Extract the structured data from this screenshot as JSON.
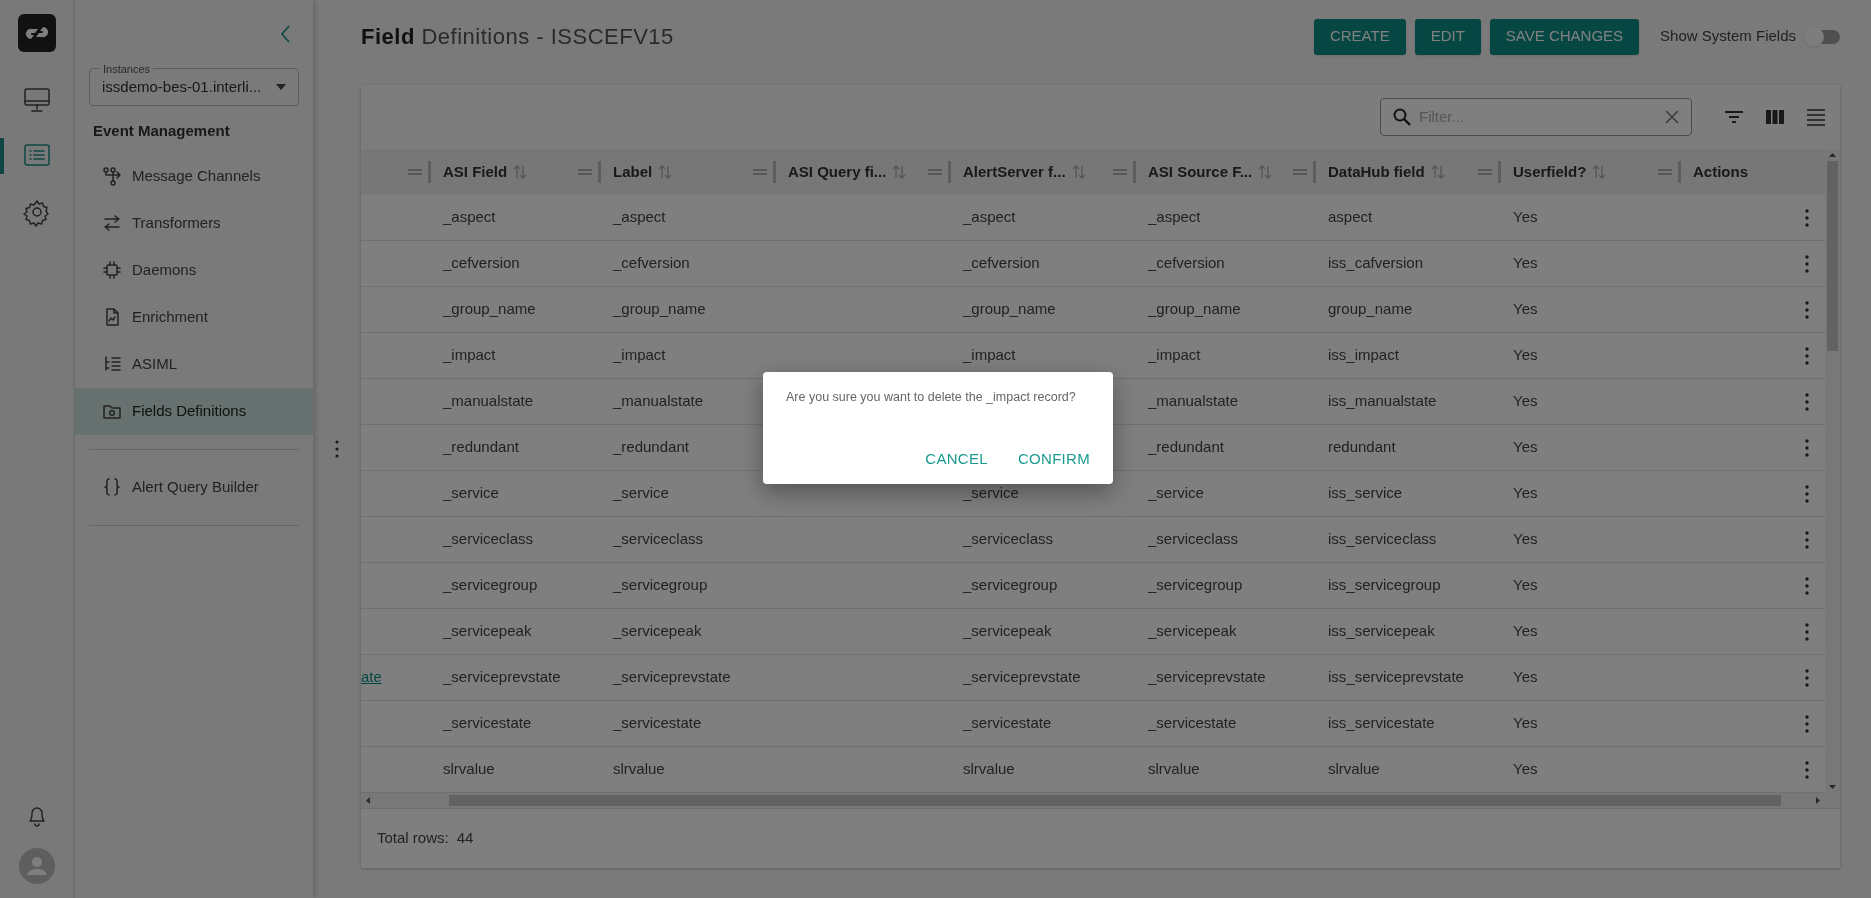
{
  "rail": {
    "items": [
      {
        "kind": "monitor",
        "selected": false
      },
      {
        "kind": "list",
        "selected": true
      },
      {
        "kind": "settings",
        "selected": false
      }
    ]
  },
  "sidebar": {
    "instances_label": "Instances",
    "instance_value": "issdemo-bes-01.interli...",
    "section_title": "Event Management",
    "items": [
      {
        "label": "Message Channels",
        "kind": "channels",
        "selected": false
      },
      {
        "label": "Transformers",
        "kind": "transform",
        "selected": false
      },
      {
        "label": "Daemons",
        "kind": "chip",
        "selected": false
      },
      {
        "label": "Enrichment",
        "kind": "file",
        "selected": false
      },
      {
        "label": "ASIML",
        "kind": "tree",
        "selected": false
      },
      {
        "label": "Fields Definitions",
        "kind": "folder",
        "selected": true
      }
    ],
    "bottom_items": [
      {
        "label": "Alert Query Builder",
        "kind": "braces",
        "selected": false
      }
    ]
  },
  "page": {
    "title": "**Field** Definitions - ISSCEFV15"
  },
  "buttons": [
    "CREATE",
    "EDIT",
    "SAVE CHANGES"
  ],
  "show_system_fields": {
    "label": "Show System Fields",
    "on": false
  },
  "filter": {
    "placeholder": "Filter..."
  },
  "table": {
    "columns": [
      "ASI Field",
      "Label",
      "ASI Query fi...",
      "AlertServer f...",
      "ASI Source F...",
      "DataHub field",
      "Userfield?",
      "Actions"
    ],
    "rows": [
      {
        "asi_field": "_aspect",
        "label": "_aspect",
        "alertserver": "_aspect",
        "asi_source": "_aspect",
        "datahub_field": "aspect",
        "userfield": "Yes"
      },
      {
        "asi_field": "_cefversion",
        "label": "_cefversion",
        "alertserver": "_cefversion",
        "asi_source": "_cefversion",
        "datahub_field": "iss_cafversion",
        "userfield": "Yes"
      },
      {
        "asi_field": "_group_name",
        "label": "_group_name",
        "alertserver": "_group_name",
        "asi_source": "_group_name",
        "datahub_field": "group_name",
        "userfield": "Yes"
      },
      {
        "asi_field": "_impact",
        "label": "_impact",
        "alertserver": "_impact",
        "asi_source": "_impact",
        "datahub_field": "iss_impact",
        "userfield": "Yes"
      },
      {
        "asi_field": "_manualstate",
        "label": "_manualstate",
        "asi_source": "_manualstate",
        "datahub_field": "iss_manualstate",
        "userfield": "Yes"
      },
      {
        "asi_field": "_redundant",
        "label": "_redundant",
        "asi_source": "_redundant",
        "datahub_field": "redundant",
        "userfield": "Yes"
      },
      {
        "asi_field": "_service",
        "label": "_service",
        "alertserver": "_service",
        "asi_source": "_service",
        "datahub_field": "iss_service",
        "userfield": "Yes"
      },
      {
        "asi_field": "_serviceclass",
        "label": "_serviceclass",
        "alertserver": "_serviceclass",
        "asi_source": "_serviceclass",
        "datahub_field": "iss_serviceclass",
        "userfield": "Yes"
      },
      {
        "asi_field": "_servicegroup",
        "label": "_servicegroup",
        "alertserver": "_servicegroup",
        "asi_source": "_servicegroup",
        "datahub_field": "iss_servicegroup",
        "userfield": "Yes"
      },
      {
        "asi_field": "_servicepeak",
        "label": "_servicepeak",
        "alertserver": "_servicepeak",
        "asi_source": "_servicepeak",
        "datahub_field": "iss_servicepeak",
        "userfield": "Yes"
      },
      {
        "column_1": "ate",
        "asi_field": "_serviceprevstate",
        "label": "_serviceprevstate",
        "alertserver": "_serviceprevstate",
        "asi_source": "_serviceprevstate",
        "datahub_field": "iss_serviceprevstate",
        "userfield": "Yes"
      },
      {
        "asi_field": "_servicestate",
        "label": "_servicestate",
        "alertserver": "_servicestate",
        "asi_source": "_servicestate",
        "datahub_field": "iss_servicestate",
        "userfield": "Yes"
      },
      {
        "asi_field": "slrvalue",
        "label": "slrvalue",
        "alertserver": "slrvalue",
        "asi_source": "slrvalue",
        "datahub_field": "slrvalue",
        "userfield": "Yes"
      }
    ]
  },
  "footer": {
    "label": "Total rows:",
    "count": "44"
  },
  "dialog": {
    "message": "Are you sure you want to delete the _impact record?",
    "buttons": [
      "CANCEL",
      "CONFIRM"
    ]
  }
}
